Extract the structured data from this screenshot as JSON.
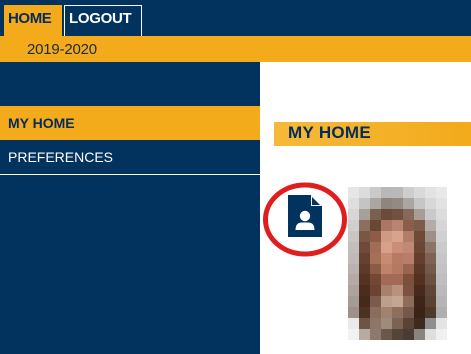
{
  "nav": {
    "tabs": [
      {
        "label": "HOME",
        "active": true
      },
      {
        "label": "LOGOUT",
        "active": false
      }
    ]
  },
  "year_bar": {
    "text": "2019-2020"
  },
  "sidebar": {
    "items": [
      {
        "label": "MY HOME",
        "active": true
      },
      {
        "label": "PREFERENCES",
        "active": false
      }
    ]
  },
  "main": {
    "title": "MY HOME",
    "document_icon": "user-document-icon",
    "photo": "profile-photo-pixelated"
  },
  "colors": {
    "navy": "#02335f",
    "gold": "#f3aa1b",
    "highlight_red": "#e01e1e"
  }
}
